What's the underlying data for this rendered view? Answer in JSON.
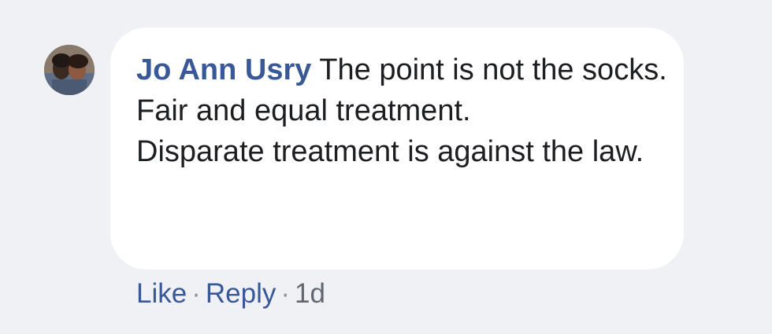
{
  "comment": {
    "author": "Jo Ann Usry",
    "text_lines": [
      "The point is not the socks.",
      "Fair and equal treatment.",
      "Disparate treatment is against the law."
    ]
  },
  "actions": {
    "like_label": "Like",
    "separator": "·",
    "reply_label": "Reply",
    "timestamp": "1d"
  },
  "colors": {
    "page_background": "#f0f1f4",
    "bubble_background": "#ffffff",
    "author_link": "#385898",
    "text": "#1c1e21",
    "meta_text": "#606770"
  },
  "icons": {
    "avatar": "user-profile-photo"
  }
}
